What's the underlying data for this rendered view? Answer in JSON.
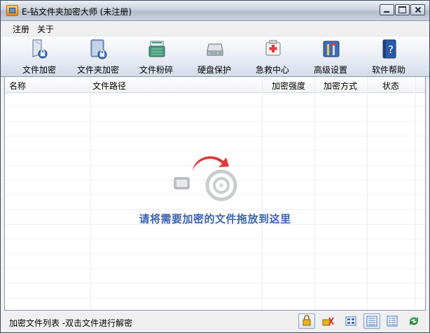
{
  "window": {
    "title": "E-钻文件夹加密大师 (未注册)"
  },
  "menu": {
    "items": [
      "注册",
      "关于"
    ]
  },
  "toolbar": {
    "items": [
      {
        "label": "文件加密",
        "icon": "file-lock-icon"
      },
      {
        "label": "文件夹加密",
        "icon": "folder-lock-icon"
      },
      {
        "label": "文件粉碎",
        "icon": "shredder-icon"
      },
      {
        "label": "硬盘保护",
        "icon": "harddisk-icon"
      },
      {
        "label": "急救中心",
        "icon": "first-aid-icon"
      },
      {
        "label": "高级设置",
        "icon": "tools-icon"
      },
      {
        "label": "软件帮助",
        "icon": "help-book-icon"
      }
    ]
  },
  "list": {
    "columns": [
      "名称",
      "文件路径",
      "加密强度",
      "加密方式",
      "状态"
    ],
    "rows": [],
    "drop_hint": "请将需要加密的文件拖放到这里"
  },
  "status": {
    "text": "加密文件列表 -双击文件进行解密",
    "buttons": [
      "lock-view-icon",
      "unlock-view-icon",
      "large-icons-view-icon",
      "list-view-icon",
      "details-view-icon",
      "refresh-icon"
    ]
  },
  "colors": {
    "drop_hint": "#3b64ad",
    "accent_red": "#e03a3a"
  }
}
